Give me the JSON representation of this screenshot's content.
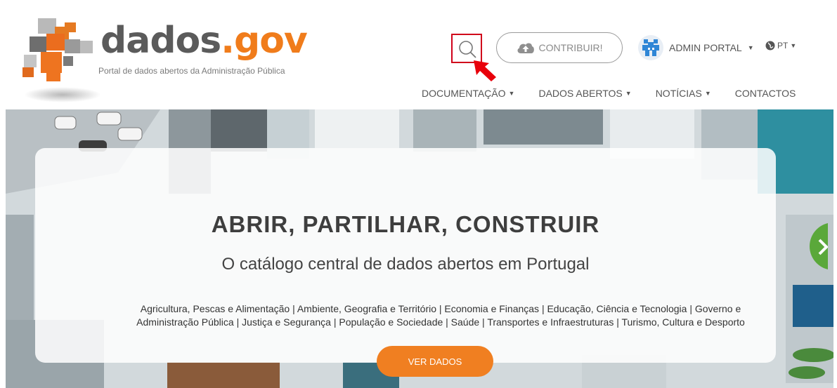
{
  "brand": {
    "name_part1": "dados",
    "name_part2": ".gov",
    "tagline": "Portal de dados abertos da Administração Pública",
    "colors": {
      "orange": "#f07c1b",
      "grey": "#5b5b5b"
    }
  },
  "header": {
    "search_icon": "search-icon",
    "contribute_label": "CONTRIBUIR!",
    "contribute_icon": "cloud-upload-icon",
    "user_label": "ADMIN PORTAL",
    "language_label": "PT",
    "language_icon": "globe-icon"
  },
  "nav": {
    "items": [
      {
        "label": "DOCUMENTAÇÃO",
        "dropdown": true
      },
      {
        "label": "DADOS ABERTOS",
        "dropdown": true
      },
      {
        "label": "NOTÍCIAS",
        "dropdown": true
      },
      {
        "label": "CONTACTOS",
        "dropdown": false
      }
    ]
  },
  "hero": {
    "title": "ABRIR, PARTILHAR, CONSTRUIR",
    "subtitle": "O catálogo central de dados abertos em Portugal",
    "categories_line1": "Agricultura, Pescas e Alimentação | Ambiente, Geografia e Território | Economia e Finanças | Educação, Ciência e Tecnologia | Governo e",
    "categories_line2": "Administração Pública | Justiça e Segurança | População e Sociedade | Saúde | Transportes e Infraestruturas | Turismo, Cultura e Desporto",
    "cta_label": "VER DADOS",
    "cta_color": "#f07f21"
  },
  "annotation": {
    "highlight_color": "#d0021b"
  }
}
